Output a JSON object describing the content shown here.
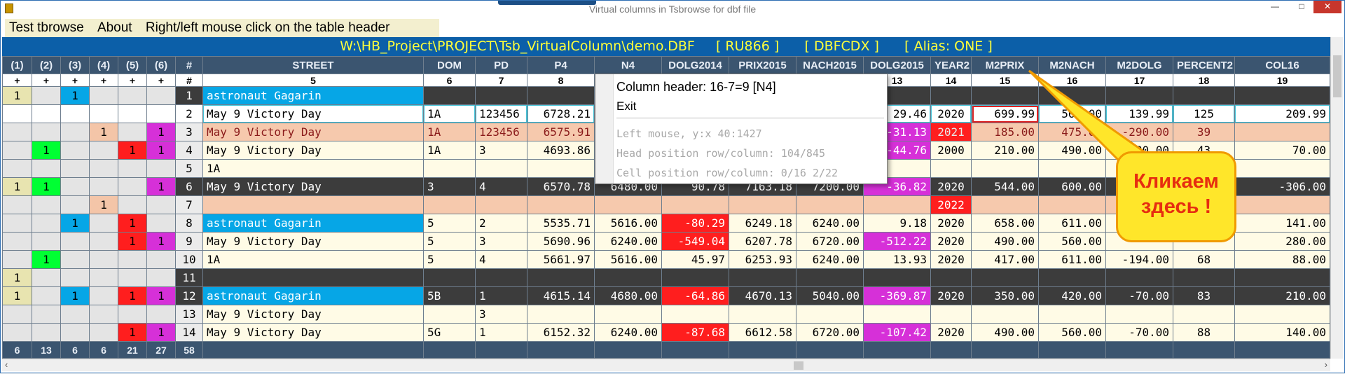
{
  "window": {
    "title": "Virtual columns in Tsbrowse for dbf file",
    "min": "—",
    "max": "□",
    "close": "✕"
  },
  "menu": [
    "Test tbrowse",
    "About",
    "Right/left mouse click on the table header"
  ],
  "path": "W:\\HB_Project\\PROJECT\\Tsb_VirtualColumn\\demo.DBF     [ RU866 ]      [ DBFCDX ]      [ Alias: ONE ]",
  "headers": [
    "(1)",
    "(2)",
    "(3)",
    "(4)",
    "(5)",
    "(6)",
    "#",
    "STREET",
    "DOM",
    "PD",
    "P4",
    "N4",
    "DOLG2014",
    "PRIX2015",
    "NACH2015",
    "DOLG2015",
    "YEAR2",
    "M2PRIX",
    "M2NACH",
    "M2DOLG",
    "PERCENT2",
    "COL16"
  ],
  "numbers": [
    "+",
    "+",
    "+",
    "+",
    "+",
    "+",
    "#",
    "5",
    "6",
    "7",
    "8",
    "9",
    "10",
    "11",
    "12",
    "13",
    "14",
    "15",
    "16",
    "17",
    "18",
    "19"
  ],
  "rows": [
    [
      "1",
      "",
      "1",
      "",
      "",
      "",
      "1",
      "astronaut Gagarin",
      "",
      "",
      "",
      "",
      "",
      "",
      "",
      "",
      "",
      "",
      "",
      "",
      "",
      ""
    ],
    [
      "",
      "",
      "",
      "",
      "",
      "",
      "2",
      "May 9 Victory Day",
      "1A",
      "123456",
      "6728.21",
      "",
      "",
      "",
      "",
      "29.46",
      "2020",
      "699.99",
      "560.00",
      "139.99",
      "125",
      "209.99"
    ],
    [
      "",
      "",
      "",
      "1",
      "",
      "1",
      "3",
      "May 9 Victory Day",
      "1A",
      "123456",
      "6575.91",
      "",
      "",
      "",
      "",
      "-31.13",
      "2021",
      "185.00",
      "475.00",
      "-290.00",
      "39",
      ""
    ],
    [
      "",
      "1",
      "",
      "",
      "1",
      "1",
      "4",
      "May 9 Victory Day",
      "1A",
      "3",
      "4693.86",
      "",
      "",
      "",
      "",
      "-44.76",
      "2000",
      "210.00",
      "490.00",
      "-280.00",
      "43",
      "70.00"
    ],
    [
      "",
      "",
      "",
      "",
      "",
      "",
      "5",
      "1A",
      "",
      "",
      "",
      "",
      "",
      "",
      "",
      "",
      "",
      "",
      "",
      "",
      "",
      ""
    ],
    [
      "1",
      "1",
      "",
      "",
      "",
      "1",
      "6",
      "May 9 Victory Day",
      "3",
      "4",
      "6570.78",
      "6480.00",
      "90.78",
      "7163.18",
      "7200.00",
      "-36.82",
      "2020",
      "544.00",
      "600.00",
      "",
      "",
      "-306.00"
    ],
    [
      "",
      "",
      "",
      "1",
      "",
      "",
      "7",
      "",
      "",
      "",
      "",
      "",
      "",
      "",
      "",
      "",
      "2022",
      "",
      "",
      "",
      "",
      ""
    ],
    [
      "",
      "",
      "1",
      "",
      "1",
      "",
      "8",
      "astronaut Gagarin",
      "5",
      "2",
      "5535.71",
      "5616.00",
      "-80.29",
      "6249.18",
      "6240.00",
      "9.18",
      "2020",
      "658.00",
      "611.00",
      "",
      "",
      "141.00"
    ],
    [
      "",
      "",
      "",
      "",
      "1",
      "1",
      "9",
      "May 9 Victory Day",
      "5",
      "3",
      "5690.96",
      "6240.00",
      "-549.04",
      "6207.78",
      "6720.00",
      "-512.22",
      "2020",
      "490.00",
      "560.00",
      "",
      "",
      "280.00"
    ],
    [
      "",
      "1",
      "",
      "",
      "",
      "",
      "10",
      "1A",
      "5",
      "4",
      "5661.97",
      "5616.00",
      "45.97",
      "6253.93",
      "6240.00",
      "13.93",
      "2020",
      "417.00",
      "611.00",
      "-194.00",
      "68",
      "88.00"
    ],
    [
      "1",
      "",
      "",
      "",
      "",
      "",
      "11",
      "",
      "",
      "",
      "",
      "",
      "",
      "",
      "",
      "",
      "",
      "",
      "",
      "",
      "",
      ""
    ],
    [
      "1",
      "",
      "1",
      "",
      "1",
      "1",
      "12",
      "astronaut Gagarin",
      "5B",
      "1",
      "4615.14",
      "4680.00",
      "-64.86",
      "4670.13",
      "5040.00",
      "-369.87",
      "2020",
      "350.00",
      "420.00",
      "-70.00",
      "83",
      "210.00"
    ],
    [
      "",
      "",
      "",
      "",
      "",
      "",
      "13",
      "May 9 Victory Day",
      "",
      "3",
      "",
      "",
      "",
      "",
      "",
      "",
      "",
      "",
      "",
      "",
      "",
      ""
    ],
    [
      "",
      "",
      "",
      "",
      "1",
      "1",
      "14",
      "May 9 Victory Day",
      "5G",
      "1",
      "6152.32",
      "6240.00",
      "-87.68",
      "6612.58",
      "6720.00",
      "-107.42",
      "2020",
      "490.00",
      "560.00",
      "-70.00",
      "88",
      "140.00"
    ]
  ],
  "footer": [
    "6",
    "13",
    "6",
    "6",
    "21",
    "27",
    "58"
  ],
  "popup": {
    "item1": "Column header: 16-7=9  [N4]",
    "item2": "Exit",
    "info1": "Left mouse, y:x 40:1427",
    "info2": "Head position row/column: 104/845",
    "info3": "Cell position row/column: 0/16  2/22"
  },
  "callout": {
    "line1": "Кликаем",
    "line2": "здесь !"
  },
  "colors": {
    "header": "#3b5570",
    "path_bg": "#0c5fa8",
    "path_text": "#ffff3a",
    "cyan": "#06a6e6",
    "green": "#00ff33",
    "red": "#ff1e1e",
    "magenta": "#d630d8",
    "salmon": "#f4c5a8",
    "dark_row": "#3c3c3c",
    "cream": "#fffbe6"
  }
}
